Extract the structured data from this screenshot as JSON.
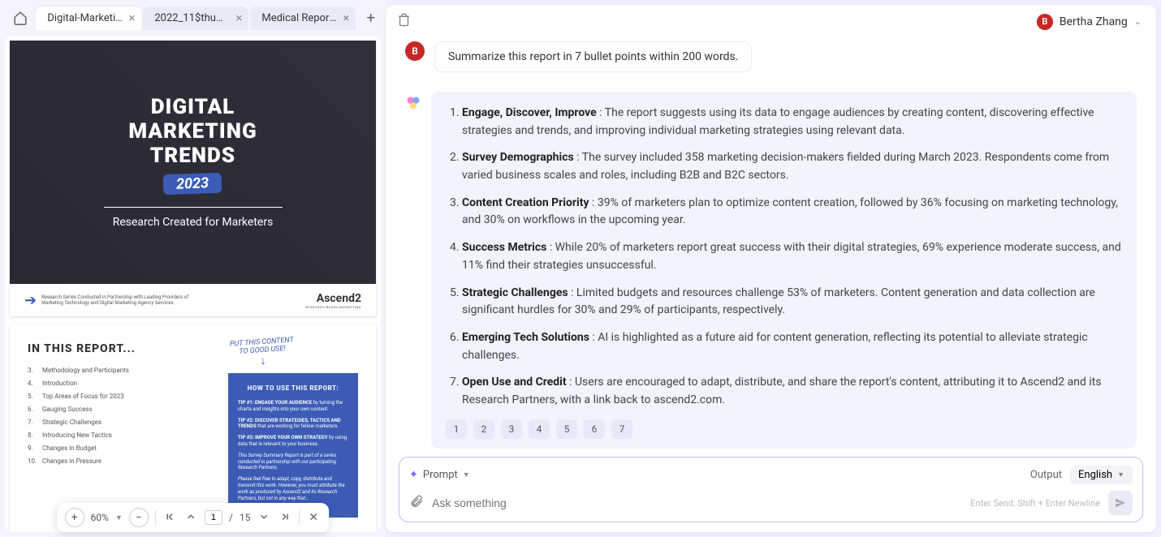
{
  "tabs": [
    {
      "label": "Digital-Marketi...",
      "active": true
    },
    {
      "label": "2022_11$thum...",
      "active": false
    },
    {
      "label": "Medical Report...",
      "active": false
    }
  ],
  "doc": {
    "cover": {
      "title_l1": "DIGITAL",
      "title_l2": "MARKETING",
      "title_l3": "TRENDS",
      "year": "2023",
      "subtitle": "Research Created for Marketers",
      "footer_txt": "Research Series Conducted in Partnership with Leading Providers of Marketing Technology and Digital Marketing Agency Services.",
      "brand": "Ascend2",
      "brand_sub": "RESEARCH-BASED MARKETING"
    },
    "page2": {
      "heading": "IN THIS REPORT...",
      "handwritten": "PUT THIS CONTENT\nTO GOOD USE!",
      "toc": [
        {
          "n": "3.",
          "t": "Methodology and Participants"
        },
        {
          "n": "4.",
          "t": "Introduction"
        },
        {
          "n": "5.",
          "t": "Top Areas of Focus for 2023"
        },
        {
          "n": "6.",
          "t": "Gauging Success"
        },
        {
          "n": "7.",
          "t": "Strategic Challenges"
        },
        {
          "n": "8.",
          "t": "Introducing New Tactics"
        },
        {
          "n": "9.",
          "t": "Changes in Budget"
        },
        {
          "n": "10.",
          "t": "Changes in Pressure"
        }
      ],
      "bluebox": {
        "heading": "HOW TO USE THIS REPORT:",
        "tips": [
          "<b>TIP #1: ENGAGE YOUR AUDIENCE</b> by turning the charts and insights into your own content.",
          "<b>TIP #2: DISCOVER STRATEGIES, TACTICS AND TRENDS</b> that are working for fellow marketers.",
          "<b>TIP #3: IMPROVE YOUR OWN STRATEGY</b> by using data that is relevant to your business.",
          "<i>This Survey Summary Report is part of a series conducted in partnership with our participating Research Partners.</i>",
          "<i>Please feel free to adapt, copy, distribute and transmit this work. However, you must attribute the work as produced by Ascend2 and its Research Partners, but not in any way that...</i>"
        ]
      }
    },
    "toolbar": {
      "zoom": "60%",
      "page_current": "1",
      "page_sep": "/",
      "page_total": "15"
    }
  },
  "user": {
    "initial": "B",
    "name": "Bertha Zhang"
  },
  "chat": {
    "user_msg": "Summarize this report in 7 bullet points within 200 words.",
    "bullets": [
      {
        "h": "Engage, Discover, Improve",
        "b": " : The report suggests using its data to engage audiences by creating content, discovering effective strategies and trends, and improving individual marketing strategies using relevant data."
      },
      {
        "h": "Survey Demographics",
        "b": " : The survey included 358 marketing decision-makers fielded during March 2023. Respondents come from varied business scales and roles, including B2B and B2C sectors."
      },
      {
        "h": "Content Creation Priority",
        "b": " : 39% of marketers plan to optimize content creation, followed by 36% focusing on marketing technology, and 30% on workflows in the upcoming year."
      },
      {
        "h": "Success Metrics",
        "b": " : While 20% of marketers report great success with their digital strategies, 69% experience moderate success, and 11% find their strategies unsuccessful."
      },
      {
        "h": "Strategic Challenges",
        "b": " : Limited budgets and resources challenge 53% of marketers. Content generation and data collection are significant hurdles for 30% and 29% of participants, respectively."
      },
      {
        "h": "Emerging Tech Solutions",
        "b": " : AI is highlighted as a future aid for content generation, reflecting its potential to alleviate strategic challenges."
      },
      {
        "h": "Open Use and Credit",
        "b": " : Users are encouraged to adapt, distribute, and share the report's content, attributing it to Ascend2 and its Research Partners, with a link back to ascend2.com."
      }
    ],
    "refs": [
      "1",
      "2",
      "3",
      "4",
      "5",
      "6",
      "7"
    ]
  },
  "input": {
    "prompt_label": "Prompt",
    "output_label": "Output",
    "language": "English",
    "placeholder": "Ask something",
    "hint": "Enter Send; Shift + Enter Newline"
  }
}
